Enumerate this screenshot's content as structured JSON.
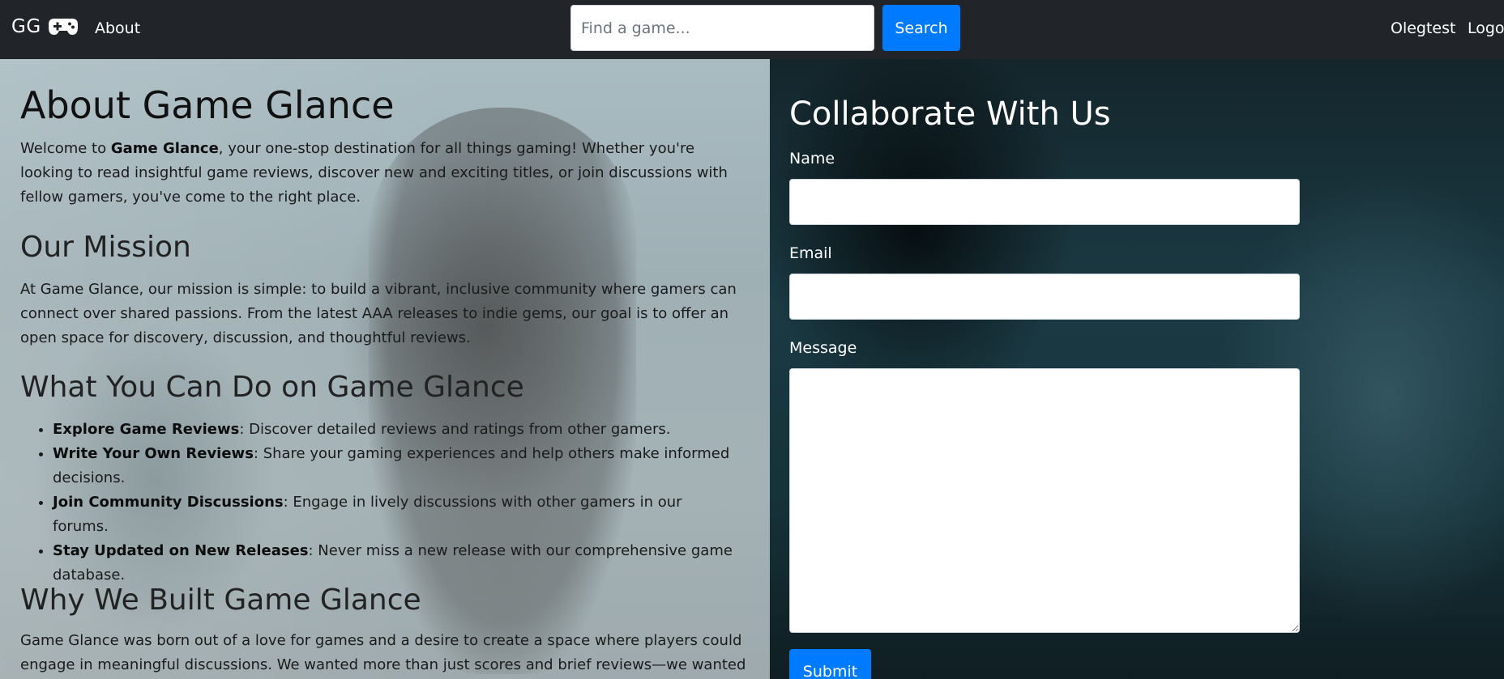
{
  "navbar": {
    "brand_text": "GG",
    "brand_icon": "gamepad-icon",
    "about_link": "About",
    "search": {
      "placeholder": "Find a game...",
      "value": ""
    },
    "search_button": "Search",
    "username": "Olegtest",
    "logout": "Logout"
  },
  "about": {
    "title": "About Game Glance",
    "welcome": {
      "before": "Welcome to ",
      "bold": "Game Glance",
      "after": ", your one-stop destination for all things gaming! Whether you're looking to read insightful game reviews, discover new and exciting titles, or join discussions with fellow gamers, you've come to the right place."
    },
    "mission_title": "Our Mission",
    "mission_text": "At Game Glance, our mission is simple: to build a vibrant, inclusive community where gamers can connect over shared passions. From the latest AAA releases to indie gems, our goal is to offer an open space for discovery, discussion, and thoughtful reviews.",
    "do_title": "What You Can Do on Game Glance",
    "features": [
      {
        "bold": "Explore Game Reviews",
        "text": ": Discover detailed reviews and ratings from other gamers."
      },
      {
        "bold": "Write Your Own Reviews",
        "text": ": Share your gaming experiences and help others make informed decisions."
      },
      {
        "bold": "Join Community Discussions",
        "text": ": Engage in lively discussions with other gamers in our forums."
      },
      {
        "bold": "Stay Updated on New Releases",
        "text": ": Never miss a new release with our comprehensive game database."
      }
    ],
    "why_title": "Why We Built Game Glance",
    "why_text": "Game Glance was born out of a love for games and a desire to create a space where players could engage in meaningful discussions. We wanted more than just scores and brief reviews—we wanted"
  },
  "collaborate": {
    "title": "Collaborate With Us",
    "name_label": "Name",
    "name_value": "",
    "email_label": "Email",
    "email_value": "",
    "message_label": "Message",
    "message_value": "",
    "submit_label": "Submit"
  },
  "colors": {
    "navbar_bg": "#212529",
    "primary": "#007bff"
  }
}
